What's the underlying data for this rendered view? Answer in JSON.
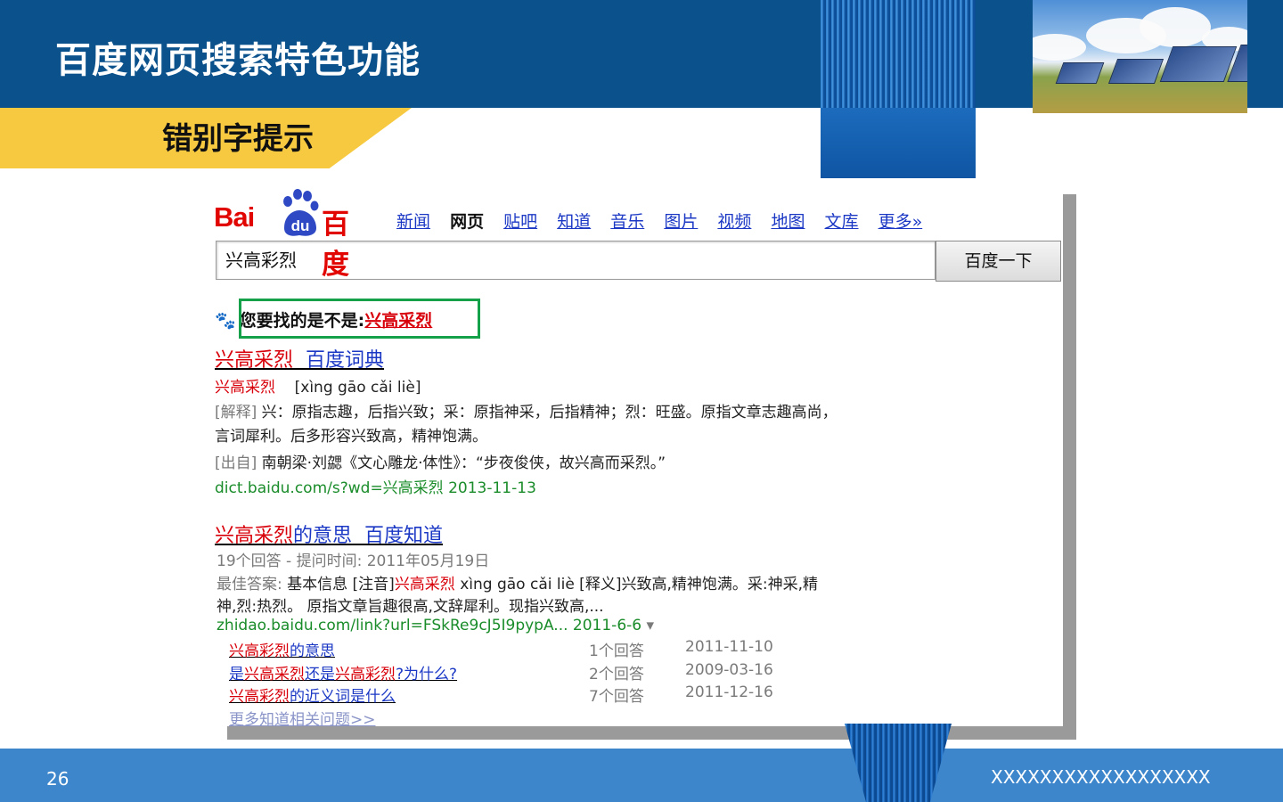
{
  "slide": {
    "title": "百度网页搜索特色功能",
    "subtitle": "错别字提示",
    "page_number": "26",
    "footer": "XXXXXXXXXXXXXXXXXX"
  },
  "baidu": {
    "logo_text_left": "Bai",
    "logo_text_paw": "du",
    "logo_text_cn": "百度",
    "nav": [
      "新闻",
      "网页",
      "贴吧",
      "知道",
      "音乐",
      "图片",
      "视频",
      "地图",
      "文库",
      "更多»"
    ],
    "active_nav": "网页",
    "search_value": "兴高彩烈",
    "search_button": "百度一下",
    "suggest_prefix": "您要找的是不是:",
    "suggest_term": "兴高采烈",
    "result1": {
      "title_red": "兴高采烈",
      "title_blue": "百度词典",
      "word": "兴高采烈",
      "pinyin": "[xìng gāo cǎi liè]",
      "explain_label": "[解释]",
      "explain_1": "兴：原指志趣，后指兴致；采：原指神采，后指精神；烈：旺盛。原指文章志趣高尚，",
      "explain_2": "言词犀利。后多形容兴致高，精神饱满。",
      "source_label": "[出自]",
      "source_text": "南朝梁·刘勰《文心雕龙·体性》：“步夜俊侠，故兴高而采烈。”",
      "url": "dict.baidu.com/s?wd=兴高采烈  2013-11-13"
    },
    "result2": {
      "title_red": "兴高采烈",
      "title_blue_1": "的意思",
      "title_blue_2": "百度知道",
      "meta": "19个回答 - 提问时间: 2011年05月19日",
      "best_label": "最佳答案:",
      "best_1a": "基本信息  [注音]",
      "best_1b": "兴高采烈",
      "best_1c": "  xìng gāo   cǎi   liè [释义]兴致高,精神饱满。采:神采,精",
      "best_2": "神,烈:热烈。  原指文章旨趣很高,文辞犀利。现指兴致高,...",
      "url": "zhidao.baidu.com/link?url=FSkRe9cJ5I9pypA... 2011-6-6",
      "url_arrow": "▾"
    },
    "related": [
      {
        "q_red": "兴高彩烈",
        "q_blue": "的意思",
        "count": "1个回答",
        "date": "2011-11-10"
      },
      {
        "q_pre": "是",
        "q_red1": "兴高采烈",
        "q_mid": "还是",
        "q_red2": "兴高彩烈",
        "q_post": "?为什么?",
        "count": "2个回答",
        "date": "2009-03-16"
      },
      {
        "q_red": "兴高彩烈",
        "q_blue": "的近义词是什么",
        "count": "7个回答",
        "date": "2011-12-16"
      }
    ],
    "more_related": "更多知道相关问题>>"
  },
  "colors": {
    "top_band": "#0b528d",
    "accent_yellow": "#f6c940",
    "bottom_band": "#3d86cc",
    "baidu_red": "#d8000a",
    "baidu_blue": "#1b38c5",
    "highlight_green": "#15a149"
  }
}
